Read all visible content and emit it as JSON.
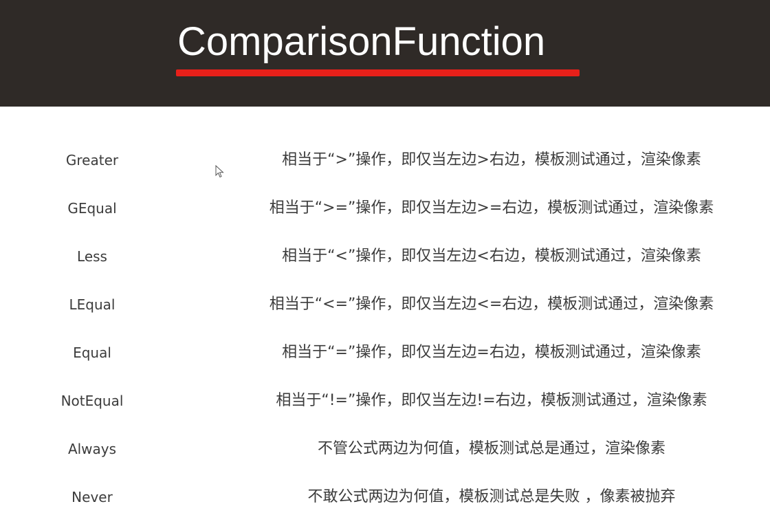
{
  "title": "ComparisonFunction",
  "colors": {
    "header_bg": "#2f2a27",
    "accent_underline": "#e8201a",
    "body_text": "#3b3b3b"
  },
  "rows": [
    {
      "term": "Greater",
      "description": "相当于“>”操作，即仅当左边>右边，模板测试通过，渲染像素"
    },
    {
      "term": "GEqual",
      "description": "相当于“>=”操作，即仅当左边>=右边，模板测试通过，渲染像素"
    },
    {
      "term": "Less",
      "description": "相当于“<”操作，即仅当左边<右边，模板测试通过，渲染像素"
    },
    {
      "term": "LEqual",
      "description": "相当于“<=”操作，即仅当左边<=右边，模板测试通过，渲染像素"
    },
    {
      "term": "Equal",
      "description": "相当于“=”操作，即仅当左边=右边，模板测试通过，渲染像素"
    },
    {
      "term": "NotEqual",
      "description": "相当于“!=”操作，即仅当左边!=右边，模板测试通过，渲染像素"
    },
    {
      "term": "Always",
      "description": "不管公式两边为何值，模板测试总是通过，渲染像素"
    },
    {
      "term": "Never",
      "description": "不敢公式两边为何值，模板测试总是失败 ，像素被抛弃"
    }
  ],
  "cursor_icon": "mouse-pointer-icon"
}
